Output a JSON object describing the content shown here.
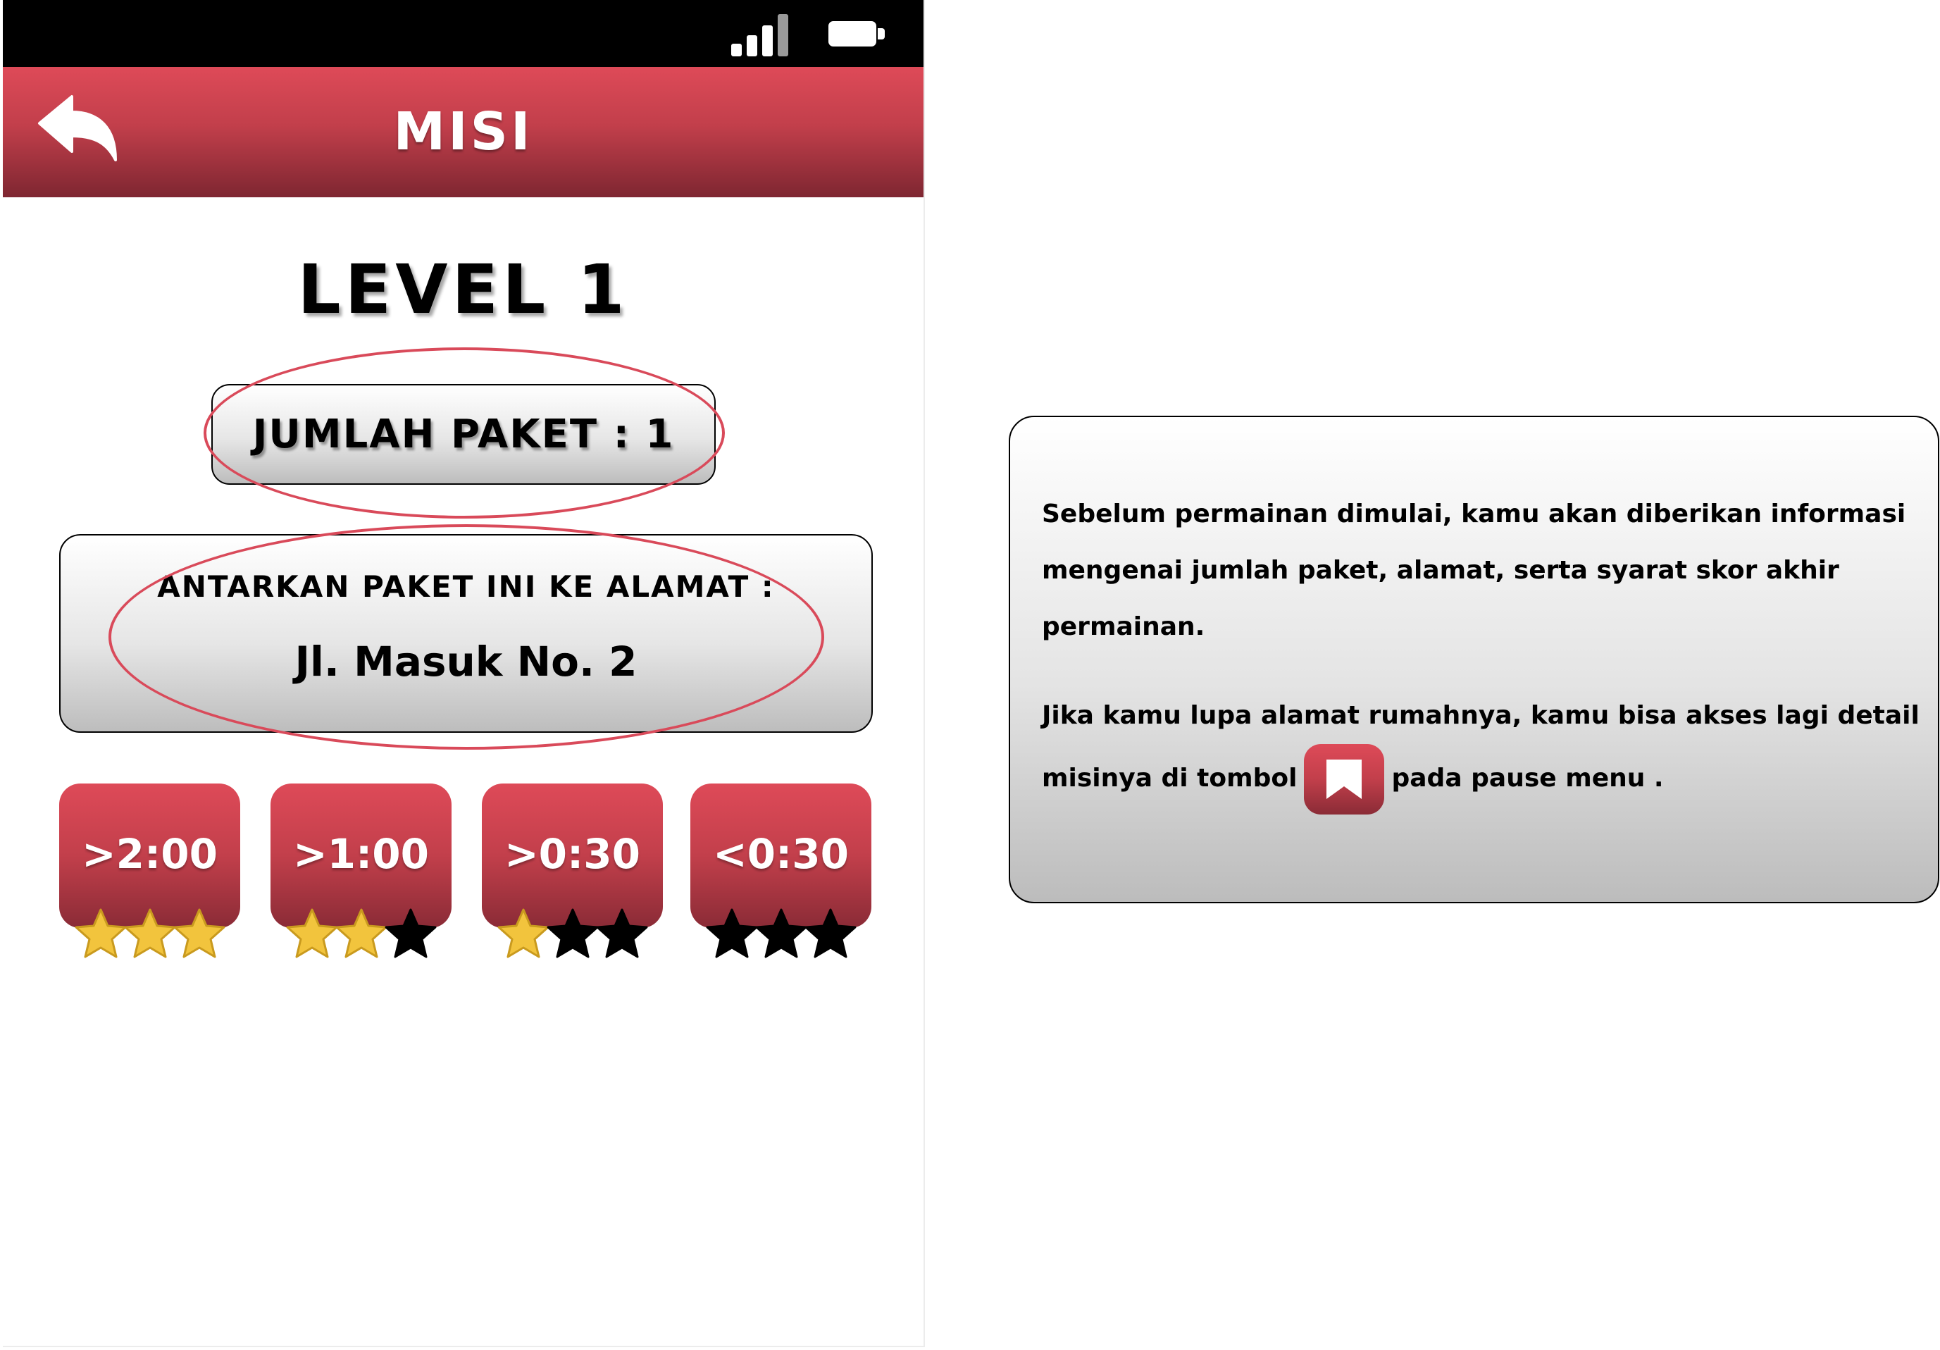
{
  "header": {
    "title": "MISI",
    "back_icon": "back-arrow-icon"
  },
  "status_bar": {
    "icons": [
      "signal-icon",
      "battery-icon"
    ]
  },
  "level": {
    "title": "LEVEL 1"
  },
  "paket": {
    "label": "JUMLAH PAKET : 1"
  },
  "address": {
    "label": "ANTARKAN PAKET INI KE ALAMAT :",
    "value": "Jl. Masuk No. 2"
  },
  "tiers": [
    {
      "time": ">2:00",
      "stars_earned": 3,
      "stars_total": 3
    },
    {
      "time": ">1:00",
      "stars_earned": 2,
      "stars_total": 3
    },
    {
      "time": ">0:30",
      "stars_earned": 1,
      "stars_total": 3
    },
    {
      "time": "<0:30",
      "stars_earned": 0,
      "stars_total": 3
    }
  ],
  "info": {
    "paragraph_1": "Sebelum permainan dimulai, kamu akan diberikan informasi mengenai jumlah paket, alamat, serta syarat skor akhir permainan.",
    "paragraph_2_before": "Jika kamu lupa alamat rumahnya, kamu bisa akses lagi detail misinya di tombol",
    "paragraph_2_after": "pada pause menu .",
    "button_icon": "bookmark-icon"
  },
  "colors": {
    "accent_red": "#d94a5a",
    "star_gold": "#f2c43d",
    "star_empty": "#000000"
  }
}
